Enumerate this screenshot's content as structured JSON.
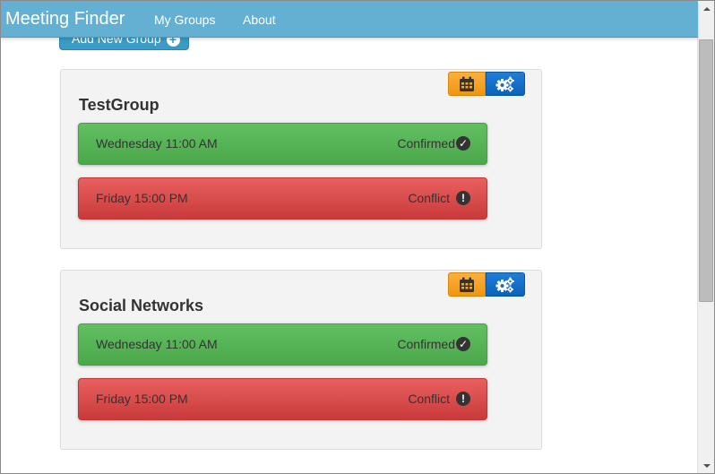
{
  "navbar": {
    "brand": "Meeting Finder",
    "links": [
      "My Groups",
      "About"
    ]
  },
  "toolbar": {
    "add_group_label": "Add New Group"
  },
  "groups": [
    {
      "name": "TestGroup",
      "meetings": [
        {
          "time": "Wednesday 11:00 AM",
          "status": "Confirmed",
          "status_icon": "check-circle-icon",
          "color": "#5cb85c"
        },
        {
          "time": "Friday 15:00 PM",
          "status": "Conflict",
          "status_icon": "exclamation-circle-icon",
          "color": "#d9534f"
        }
      ]
    },
    {
      "name": "Social Networks",
      "meetings": [
        {
          "time": "Wednesday 11:00 AM",
          "status": "Confirmed",
          "status_icon": "check-circle-icon",
          "color": "#5cb85c"
        },
        {
          "time": "Friday 15:00 PM",
          "status": "Conflict",
          "status_icon": "exclamation-circle-icon",
          "color": "#d9534f"
        }
      ]
    }
  ],
  "colors": {
    "navbar": "#63b0d2",
    "calendar_button": "#f0960d",
    "settings_button": "#0a62b8",
    "confirmed": "#5cb85c",
    "conflict": "#d9534f"
  }
}
